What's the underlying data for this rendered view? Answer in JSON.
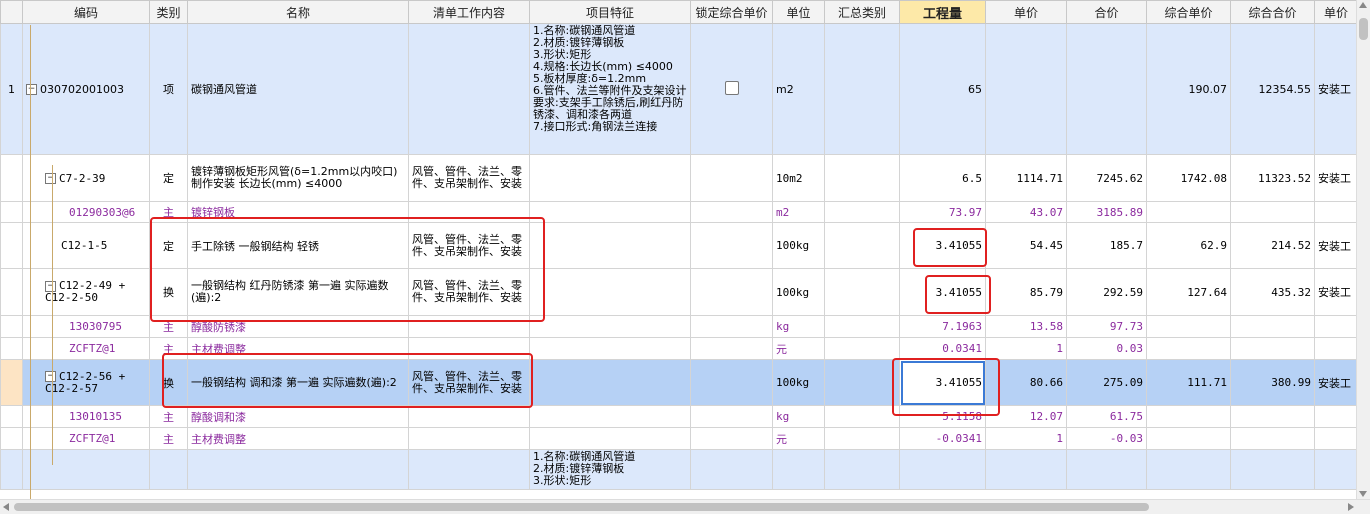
{
  "headers": [
    "编码",
    "类别",
    "名称",
    "清单工作内容",
    "项目特征",
    "锁定综合单价",
    "单位",
    "汇总类别",
    "工程量",
    "单价",
    "合价",
    "综合单价",
    "综合合价",
    "单价"
  ],
  "rows": [
    {
      "rownum": "1",
      "code": "030702001003",
      "type": "项",
      "name": "碳钢通风管道",
      "work": "",
      "feature": "1.名称:碳钢通风管道\n2.材质:镀锌薄钢板\n3.形状:矩形\n4.规格:长边长(mm) ≤4000\n5.板材厚度:δ=1.2mm\n6.管件、法兰等附件及支架设计要求:支架手工除锈后,刷红丹防锈漆、调和漆各两道\n7.接口形式:角钢法兰连接",
      "unit": "m2",
      "qty": "65",
      "price": "",
      "total": "",
      "cprice": "190.07",
      "ctotal": "12354.55",
      "extra": "安装工"
    },
    {
      "rownum": "",
      "code": "C7-2-39",
      "type": "定",
      "name": "镀锌薄钢板矩形风管(δ=1.2mm以内咬口)制作安装 长边长(mm) ≤4000",
      "work": "风管、管件、法兰、零件、支吊架制作、安装",
      "feature": "",
      "unit": "10m2",
      "qty": "6.5",
      "price": "1114.71",
      "total": "7245.62",
      "cprice": "1742.08",
      "ctotal": "11323.52",
      "extra": "安装工"
    },
    {
      "rownum": "",
      "code": "01290303@6",
      "type": "主",
      "name": "镀锌钢板",
      "work": "",
      "feature": "",
      "unit": "m2",
      "qty": "73.97",
      "price": "43.07",
      "total": "3185.89",
      "cprice": "",
      "ctotal": "",
      "extra": ""
    },
    {
      "rownum": "",
      "code": "C12-1-5",
      "type": "定",
      "name": "手工除锈 一般钢结构 轻锈",
      "work": "风管、管件、法兰、零件、支吊架制作、安装",
      "feature": "",
      "unit": "100kg",
      "qty": "3.41055",
      "price": "54.45",
      "total": "185.7",
      "cprice": "62.9",
      "ctotal": "214.52",
      "extra": "安装工"
    },
    {
      "rownum": "",
      "code": "C12-2-49 + C12-2-50",
      "type": "换",
      "name": "一般钢结构 红丹防锈漆 第一遍 实际遍数(遍):2",
      "work": "风管、管件、法兰、零件、支吊架制作、安装",
      "feature": "",
      "unit": "100kg",
      "qty": "3.41055",
      "price": "85.79",
      "total": "292.59",
      "cprice": "127.64",
      "ctotal": "435.32",
      "extra": "安装工"
    },
    {
      "rownum": "",
      "code": "13030795",
      "type": "主",
      "name": "醇酸防锈漆",
      "work": "",
      "feature": "",
      "unit": "kg",
      "qty": "7.1963",
      "price": "13.58",
      "total": "97.73",
      "cprice": "",
      "ctotal": "",
      "extra": ""
    },
    {
      "rownum": "",
      "code": "ZCFTZ@1",
      "type": "主",
      "name": "主材费调整",
      "work": "",
      "feature": "",
      "unit": "元",
      "qty": "0.0341",
      "price": "1",
      "total": "0.03",
      "cprice": "",
      "ctotal": "",
      "extra": ""
    },
    {
      "rownum": "",
      "code": "C12-2-56 + C12-2-57",
      "type": "换",
      "name": "一般钢结构 调和漆 第一遍 实际遍数(遍):2",
      "work": "风管、管件、法兰、零件、支吊架制作、安装",
      "feature": "",
      "unit": "100kg",
      "qty": "3.41055",
      "price": "80.66",
      "total": "275.09",
      "cprice": "111.71",
      "ctotal": "380.99",
      "extra": "安装工"
    },
    {
      "rownum": "",
      "code": "13010135",
      "type": "主",
      "name": "醇酸调和漆",
      "work": "",
      "feature": "",
      "unit": "kg",
      "qty": "5.1158",
      "price": "12.07",
      "total": "61.75",
      "cprice": "",
      "ctotal": "",
      "extra": ""
    },
    {
      "rownum": "",
      "code": "ZCFTZ@1",
      "type": "主",
      "name": "主材费调整",
      "work": "",
      "feature": "",
      "unit": "元",
      "qty": "-0.0341",
      "price": "1",
      "total": "-0.03",
      "cprice": "",
      "ctotal": "",
      "extra": ""
    },
    {
      "rownum": "",
      "code": "",
      "type": "",
      "name": "",
      "work": "",
      "feature": "1.名称:碳钢通风管道\n2.材质:镀锌薄钢板\n3.形状:矩形",
      "unit": "",
      "qty": "",
      "price": "",
      "total": "",
      "cprice": "",
      "ctotal": "",
      "extra": ""
    }
  ],
  "colors": {
    "level1_bg": "#dce8fb",
    "selected_bg": "#b6d1f5",
    "material_text": "#8b2a9e",
    "highlight_box": "#e02020",
    "qty_header": "#fde9a8"
  }
}
